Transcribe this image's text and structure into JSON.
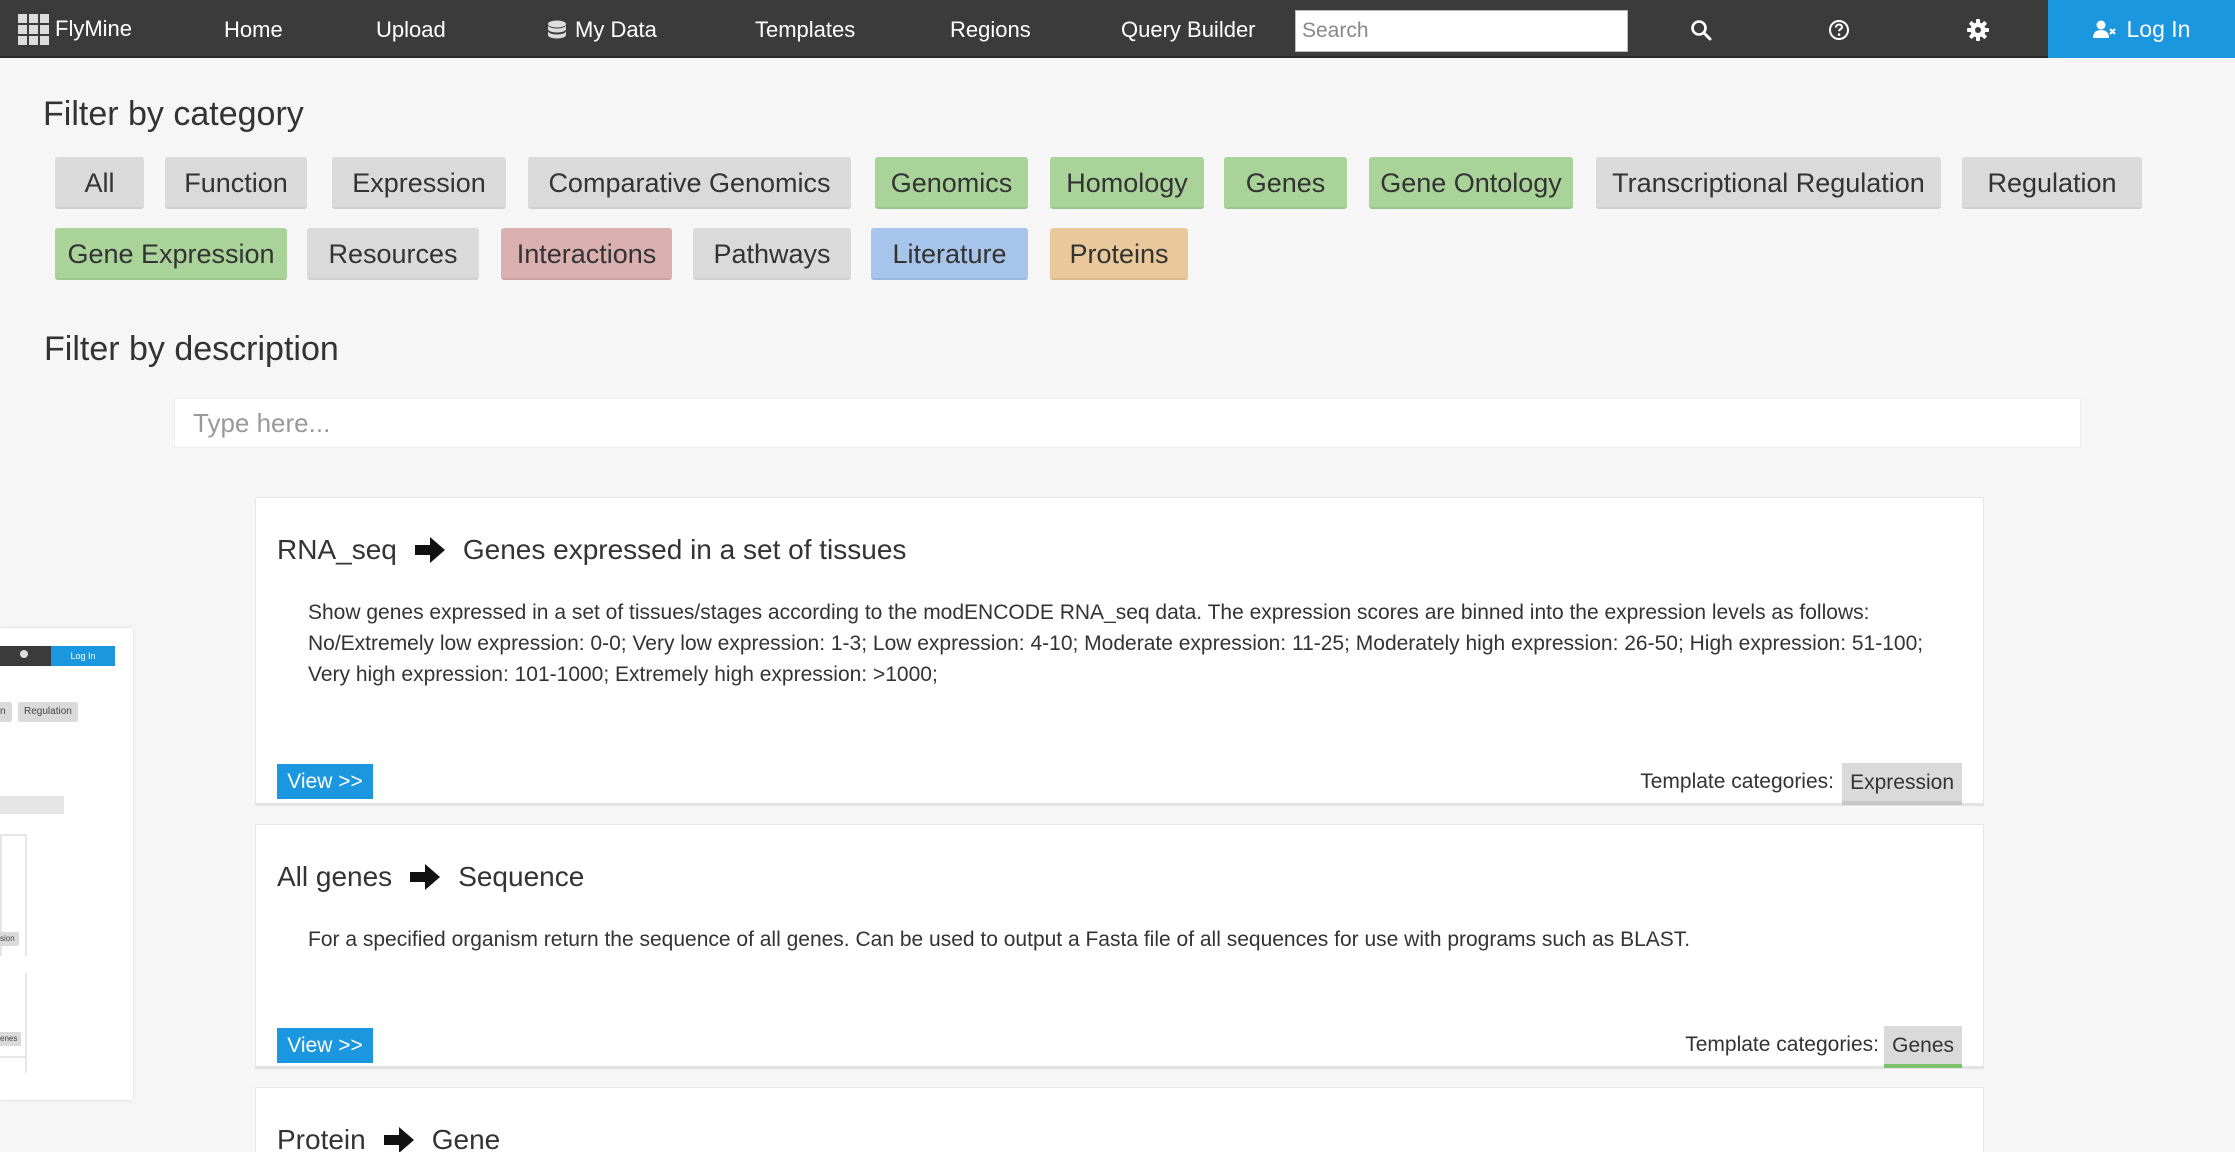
{
  "nav": {
    "brand": "FlyMine",
    "home": "Home",
    "upload": "Upload",
    "my_data": "My Data",
    "templates": "Templates",
    "regions": "Regions",
    "query_builder": "Query Builder",
    "search_placeholder": "Search",
    "login": "Log In"
  },
  "filter_category": {
    "heading": "Filter by category",
    "chips": [
      {
        "label": "All",
        "color": "#dadada"
      },
      {
        "label": "Function",
        "color": "#dadada"
      },
      {
        "label": "Expression",
        "color": "#dadada"
      },
      {
        "label": "Comparative Genomics",
        "color": "#dadada"
      },
      {
        "label": "Genomics",
        "color": "#aad39a"
      },
      {
        "label": "Homology",
        "color": "#aad39a"
      },
      {
        "label": "Genes",
        "color": "#aad39a"
      },
      {
        "label": "Gene Ontology",
        "color": "#aad39a"
      },
      {
        "label": "Transcriptional Regulation",
        "color": "#dadada"
      },
      {
        "label": "Regulation",
        "color": "#dadada"
      },
      {
        "label": "Gene Expression",
        "color": "#aad39a"
      },
      {
        "label": "Resources",
        "color": "#dadada"
      },
      {
        "label": "Interactions",
        "color": "#dbb0b0"
      },
      {
        "label": "Pathways",
        "color": "#dadada"
      },
      {
        "label": "Literature",
        "color": "#a7c4eb"
      },
      {
        "label": "Proteins",
        "color": "#e9c99b"
      }
    ]
  },
  "filter_description": {
    "heading": "Filter by description",
    "placeholder": "Type here..."
  },
  "templates": [
    {
      "from": "RNA_seq",
      "to": "Genes expressed in a set of tissues",
      "description": "Show genes expressed in a set of tissues/stages according to the modENCODE RNA_seq data. The expression scores are binned into the expression levels as follows: No/Extremely low expression: 0-0; Very low expression: 1-3; Low expression: 4-10; Moderate expression: 11-25; Moderately high expression: 26-50; High expression: 51-100; Very high expression: 101-1000; Extremely high expression: >1000;",
      "view_label": "View >>",
      "categories_label": "Template categories:",
      "category": "Expression"
    },
    {
      "from": "All genes",
      "to": "Sequence",
      "description": "For a specified organism return the sequence of all genes. Can be used to output a Fasta file of all sequences for use with programs such as BLAST.",
      "view_label": "View >>",
      "categories_label": "Template categories:",
      "category": "Genes"
    },
    {
      "from": "Protein",
      "to": "Gene"
    }
  ],
  "thumbnail": {
    "login": "Log In",
    "chip_a": "n",
    "chip_b": "Regulation",
    "tag_a": "sion",
    "tag_b": "enes"
  }
}
